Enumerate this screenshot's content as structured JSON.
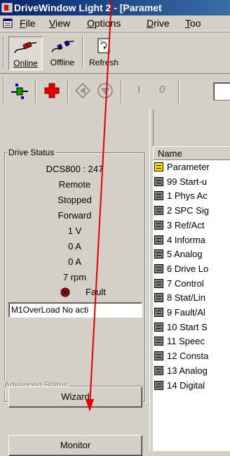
{
  "window": {
    "title": "DriveWindow Light 2 - [Paramet"
  },
  "menu": {
    "items": [
      {
        "pre": "",
        "ul": "F",
        "post": "ile"
      },
      {
        "pre": "",
        "ul": "V",
        "post": "iew"
      },
      {
        "pre": "",
        "ul": "O",
        "post": "ptions"
      },
      {
        "pre": "",
        "ul": "D",
        "post": "rive"
      },
      {
        "pre": "",
        "ul": "T",
        "post": "oo"
      }
    ]
  },
  "toolbar": {
    "online_label": "Online",
    "offline_label": "Offline",
    "refresh_label": "Refresh"
  },
  "toolbar2": {
    "start_label": "I",
    "stop_label": "0"
  },
  "drive_status": {
    "title": "Drive Status",
    "lines": [
      "DCS800 : 247",
      "Remote",
      "Stopped",
      "Forward",
      "1 V",
      "0 A",
      "0 A",
      "7 rpm"
    ],
    "fault_label": "Fault",
    "fault_field": "M1OverLoad  No acti"
  },
  "advanced_status": {
    "title": "Advanced Status"
  },
  "buttons": {
    "wizard": "Wizard",
    "monitor": "Monitor"
  },
  "list": {
    "header": "Name",
    "items": [
      {
        "label": "Parameter",
        "folder": true
      },
      {
        "label": "99  Start-u",
        "folder": false
      },
      {
        "label": "1  Phys Ac",
        "folder": false
      },
      {
        "label": "2  SPC Sig",
        "folder": false
      },
      {
        "label": "3  Ref/Act",
        "folder": false
      },
      {
        "label": "4  Informa",
        "folder": false
      },
      {
        "label": "5  Analog",
        "folder": false
      },
      {
        "label": "6  Drive Lo",
        "folder": false
      },
      {
        "label": "7  Control",
        "folder": false
      },
      {
        "label": "8  Stat/Lin",
        "folder": false
      },
      {
        "label": "9  Fault/Al",
        "folder": false
      },
      {
        "label": "10  Start S",
        "folder": false
      },
      {
        "label": "11  Speec",
        "folder": false
      },
      {
        "label": "12  Consta",
        "folder": false
      },
      {
        "label": "13  Analog",
        "folder": false
      },
      {
        "label": "14  Digital",
        "folder": false
      }
    ]
  },
  "colors": {
    "annotation_arrow": "#e00000",
    "title_bar": "#0a246a"
  }
}
